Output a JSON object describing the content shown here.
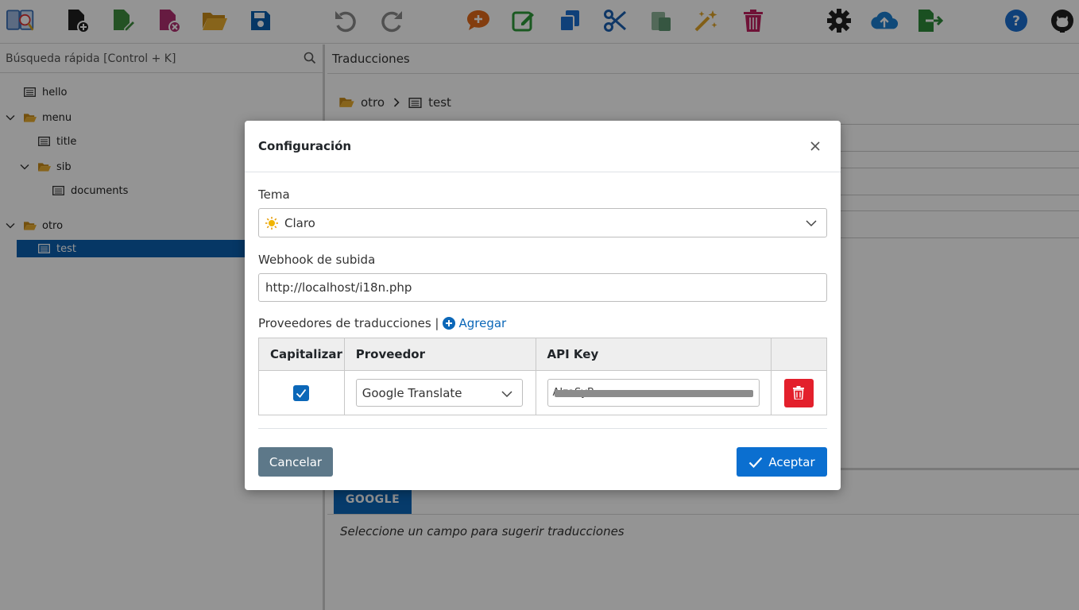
{
  "toolbar": {
    "buttons": [
      {
        "icon": "app-logo-icon",
        "color": "#3a6fb5"
      },
      {
        "icon": "new-file-icon",
        "color": "#1f1f1f"
      },
      {
        "icon": "edit-file-icon",
        "color": "#3e8e3e"
      },
      {
        "icon": "delete-file-icon",
        "color": "#b03070"
      },
      {
        "icon": "open-folder-icon",
        "color": "#e0a428"
      },
      {
        "icon": "save-icon",
        "color": "#0b5fae"
      },
      {
        "icon": "undo-icon",
        "color": "#8a8a8a"
      },
      {
        "icon": "redo-icon",
        "color": "#8a8a8a"
      },
      {
        "icon": "add-comment-icon",
        "color": "#e26a1a"
      },
      {
        "icon": "edit-icon",
        "color": "#2e9a3a"
      },
      {
        "icon": "copy-icon",
        "color": "#1a6fd0"
      },
      {
        "icon": "cut-icon",
        "color": "#1a5fb0"
      },
      {
        "icon": "paste-icon",
        "color": "#3e7e3e"
      },
      {
        "icon": "magic-wand-icon",
        "color": "#e0a428"
      },
      {
        "icon": "trash-icon",
        "color": "#c02060"
      },
      {
        "icon": "gear-icon",
        "color": "#1f1f1f"
      },
      {
        "icon": "cloud-upload-icon",
        "color": "#1a7fd0"
      },
      {
        "icon": "export-icon",
        "color": "#2e8a3a"
      },
      {
        "icon": "help-icon",
        "color": "#1a6fd0"
      },
      {
        "icon": "github-icon",
        "color": "#1f1f1f"
      }
    ]
  },
  "sidebar": {
    "search_label": "Búsqueda rápida [Control + K]",
    "tree": [
      {
        "label": "hello",
        "type": "file"
      },
      {
        "label": "menu",
        "type": "folder"
      },
      {
        "label": "title",
        "type": "file"
      },
      {
        "label": "sib",
        "type": "folder"
      },
      {
        "label": "documents",
        "type": "file"
      },
      {
        "label": "otro",
        "type": "folder"
      },
      {
        "label": "test",
        "type": "file",
        "selected": true
      }
    ]
  },
  "main": {
    "header": "Traducciones",
    "breadcrumb": {
      "folder": "otro",
      "file": "test"
    },
    "tab": "GOOGLE",
    "suggest_hint": "Seleccione un campo para sugerir traducciones"
  },
  "modal": {
    "title": "Configuración",
    "theme_label": "Tema",
    "theme_value": "Claro",
    "webhook_label": "Webhook de subida",
    "webhook_value": "http://localhost/i18n.php",
    "providers_label": "Proveedores de traducciones |",
    "add_label": "Agregar",
    "table": {
      "headers": [
        "Capitalizar",
        "Proveedor",
        "API Key",
        ""
      ],
      "rows": [
        {
          "capitalize": true,
          "provider": "Google Translate",
          "api_key": "AIzaSyB"
        }
      ]
    },
    "cancel_label": "Cancelar",
    "accept_label": "Aceptar"
  },
  "colors": {
    "primary": "#0b6fd0",
    "danger": "#e3202c",
    "secondary": "#5d7889",
    "selection": "#0b5fae"
  }
}
